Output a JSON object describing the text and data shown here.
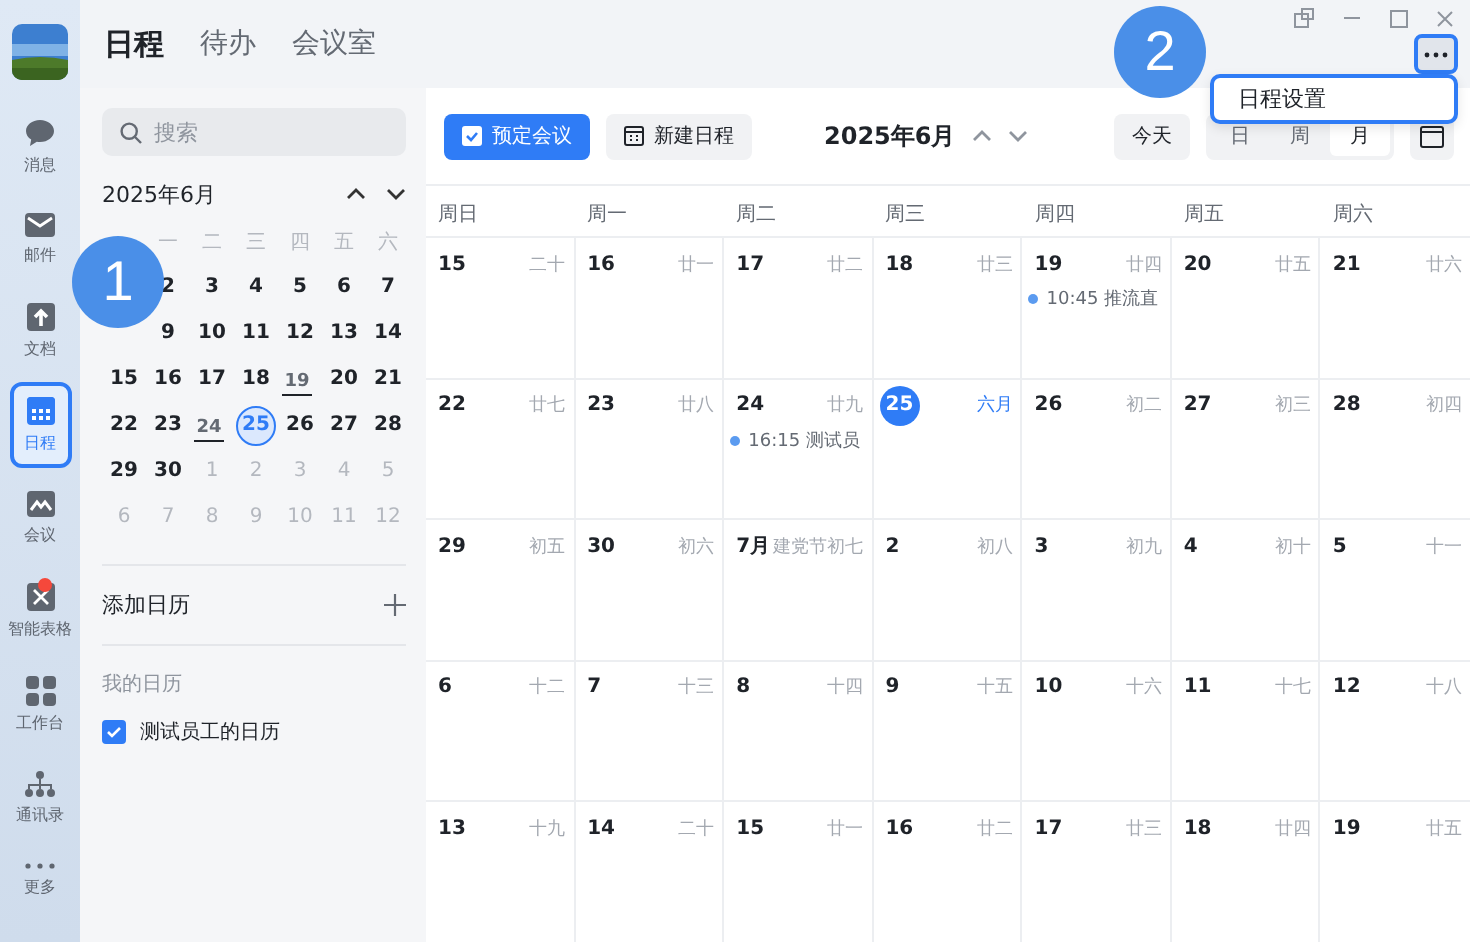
{
  "nav": [
    {
      "kind": "chat",
      "label": "消息",
      "selected": false,
      "badge": false
    },
    {
      "kind": "mail",
      "label": "邮件",
      "selected": false,
      "badge": false
    },
    {
      "kind": "doc",
      "label": "文档",
      "selected": false,
      "badge": false
    },
    {
      "kind": "calendar",
      "label": "日程",
      "selected": true,
      "badge": false
    },
    {
      "kind": "meeting",
      "label": "会议",
      "selected": false,
      "badge": false
    },
    {
      "kind": "sheet",
      "label": "智能表格",
      "selected": false,
      "badge": true
    },
    {
      "kind": "apps",
      "label": "工作台",
      "selected": false,
      "badge": false
    },
    {
      "kind": "contacts",
      "label": "通讯录",
      "selected": false,
      "badge": false
    },
    {
      "kind": "more",
      "label": "更多",
      "selected": false,
      "badge": false
    }
  ],
  "tabs": [
    {
      "label": "日程",
      "selected": true
    },
    {
      "label": "待办",
      "selected": false
    },
    {
      "label": "会议室",
      "selected": false
    }
  ],
  "more_menu": {
    "items": [
      "日程设置"
    ]
  },
  "sidebar": {
    "search": {
      "placeholder": "搜索"
    },
    "mini_calendar": {
      "title": "2025年6月",
      "weekdays": [
        "一",
        "二",
        "三",
        "四",
        "五",
        "六"
      ],
      "weeks": [
        [
          {
            "day": "2",
            "muted": false,
            "has_event": false,
            "selected": false
          },
          {
            "day": "3",
            "muted": false,
            "has_event": false,
            "selected": false
          },
          {
            "day": "4",
            "muted": false,
            "has_event": false,
            "selected": false
          },
          {
            "day": "5",
            "muted": false,
            "has_event": false,
            "selected": false
          },
          {
            "day": "6",
            "muted": false,
            "has_event": false,
            "selected": false
          },
          {
            "day": "7",
            "muted": false,
            "has_event": false,
            "selected": false
          }
        ],
        [
          {
            "day": "9",
            "muted": false,
            "has_event": false,
            "selected": false
          },
          {
            "day": "10",
            "muted": false,
            "has_event": false,
            "selected": false
          },
          {
            "day": "11",
            "muted": false,
            "has_event": false,
            "selected": false
          },
          {
            "day": "12",
            "muted": false,
            "has_event": false,
            "selected": false
          },
          {
            "day": "13",
            "muted": false,
            "has_event": false,
            "selected": false
          },
          {
            "day": "14",
            "muted": false,
            "has_event": false,
            "selected": false
          }
        ],
        [
          {
            "day": "15",
            "muted": false,
            "has_event": false,
            "selected": false
          },
          {
            "day": "16",
            "muted": false,
            "has_event": false,
            "selected": false
          },
          {
            "day": "17",
            "muted": false,
            "has_event": false,
            "selected": false
          },
          {
            "day": "18",
            "muted": false,
            "has_event": false,
            "selected": false
          },
          {
            "day": "19",
            "muted": false,
            "has_event": true,
            "selected": false
          },
          {
            "day": "20",
            "muted": false,
            "has_event": false,
            "selected": false
          },
          {
            "day": "21",
            "muted": false,
            "has_event": false,
            "selected": false
          }
        ],
        [
          {
            "day": "22",
            "muted": false,
            "has_event": false,
            "selected": false
          },
          {
            "day": "23",
            "muted": false,
            "has_event": false,
            "selected": false
          },
          {
            "day": "24",
            "muted": false,
            "has_event": true,
            "selected": false
          },
          {
            "day": "25",
            "muted": false,
            "has_event": false,
            "selected": true
          },
          {
            "day": "26",
            "muted": false,
            "has_event": false,
            "selected": false
          },
          {
            "day": "27",
            "muted": false,
            "has_event": false,
            "selected": false
          },
          {
            "day": "28",
            "muted": false,
            "has_event": false,
            "selected": false
          }
        ],
        [
          {
            "day": "29",
            "muted": false,
            "has_event": false,
            "selected": false
          },
          {
            "day": "30",
            "muted": false,
            "has_event": false,
            "selected": false
          },
          {
            "day": "1",
            "muted": true,
            "has_event": false,
            "selected": false
          },
          {
            "day": "2",
            "muted": true,
            "has_event": false,
            "selected": false
          },
          {
            "day": "3",
            "muted": true,
            "has_event": false,
            "selected": false
          },
          {
            "day": "4",
            "muted": true,
            "has_event": false,
            "selected": false
          },
          {
            "day": "5",
            "muted": true,
            "has_event": false,
            "selected": false
          }
        ],
        [
          {
            "day": "6",
            "muted": true,
            "has_event": false,
            "selected": false
          },
          {
            "day": "7",
            "muted": true,
            "has_event": false,
            "selected": false
          },
          {
            "day": "8",
            "muted": true,
            "has_event": false,
            "selected": false
          },
          {
            "day": "9",
            "muted": true,
            "has_event": false,
            "selected": false
          },
          {
            "day": "10",
            "muted": true,
            "has_event": false,
            "selected": false
          },
          {
            "day": "11",
            "muted": true,
            "has_event": false,
            "selected": false
          },
          {
            "day": "12",
            "muted": true,
            "has_event": false,
            "selected": false
          }
        ]
      ]
    },
    "add_calendar": "添加日历",
    "my_calendars_heading": "我的日历",
    "calendars": [
      {
        "name": "测试员工的日历",
        "checked": true
      }
    ]
  },
  "toolbar": {
    "book_meeting": "预定会议",
    "new_event": "新建日程",
    "month": "2025年6月",
    "today": "今天",
    "views": [
      {
        "label": "日",
        "selected": false
      },
      {
        "label": "周",
        "selected": false
      },
      {
        "label": "月",
        "selected": true
      }
    ]
  },
  "month_view": {
    "weekdays": [
      "周日",
      "周一",
      "周二",
      "周三",
      "周四",
      "周五",
      "周六"
    ],
    "weeks": [
      [
        {
          "day": "15",
          "lunar": "二十",
          "today": false
        },
        {
          "day": "16",
          "lunar": "廿一",
          "today": false
        },
        {
          "day": "17",
          "lunar": "廿二",
          "today": false
        },
        {
          "day": "18",
          "lunar": "廿三",
          "today": false
        },
        {
          "day": "19",
          "lunar": "廿四",
          "today": false,
          "events": [
            {
              "time": "10:45",
              "title": "推流直"
            }
          ]
        },
        {
          "day": "20",
          "lunar": "廿五",
          "today": false
        },
        {
          "day": "21",
          "lunar": "廿六",
          "today": false
        }
      ],
      [
        {
          "day": "22",
          "lunar": "廿七",
          "today": false
        },
        {
          "day": "23",
          "lunar": "廿八",
          "today": false
        },
        {
          "day": "24",
          "lunar": "廿九",
          "today": false,
          "events": [
            {
              "time": "16:15",
              "title": "测试员"
            }
          ]
        },
        {
          "day": "25",
          "lunar": "六月",
          "today": true
        },
        {
          "day": "26",
          "lunar": "初二",
          "today": false
        },
        {
          "day": "27",
          "lunar": "初三",
          "today": false
        },
        {
          "day": "28",
          "lunar": "初四",
          "today": false
        }
      ],
      [
        {
          "day": "29",
          "lunar": "初五",
          "today": false
        },
        {
          "day": "30",
          "lunar": "初六",
          "today": false
        },
        {
          "day": "7月",
          "lunar": "建党节初七",
          "today": false
        },
        {
          "day": "2",
          "lunar": "初八",
          "today": false
        },
        {
          "day": "3",
          "lunar": "初九",
          "today": false
        },
        {
          "day": "4",
          "lunar": "初十",
          "today": false
        },
        {
          "day": "5",
          "lunar": "十一",
          "today": false
        }
      ],
      [
        {
          "day": "6",
          "lunar": "十二",
          "today": false
        },
        {
          "day": "7",
          "lunar": "十三",
          "today": false
        },
        {
          "day": "8",
          "lunar": "十四",
          "today": false
        },
        {
          "day": "9",
          "lunar": "十五",
          "today": false
        },
        {
          "day": "10",
          "lunar": "十六",
          "today": false
        },
        {
          "day": "11",
          "lunar": "十七",
          "today": false
        },
        {
          "day": "12",
          "lunar": "十八",
          "today": false
        }
      ],
      [
        {
          "day": "13",
          "lunar": "十九",
          "today": false
        },
        {
          "day": "14",
          "lunar": "二十",
          "today": false
        },
        {
          "day": "15",
          "lunar": "廿一",
          "today": false
        },
        {
          "day": "16",
          "lunar": "廿二",
          "today": false
        },
        {
          "day": "17",
          "lunar": "廿三",
          "today": false
        },
        {
          "day": "18",
          "lunar": "廿四",
          "today": false
        },
        {
          "day": "19",
          "lunar": "廿五",
          "today": false
        }
      ]
    ]
  },
  "callouts": [
    "1",
    "2"
  ]
}
